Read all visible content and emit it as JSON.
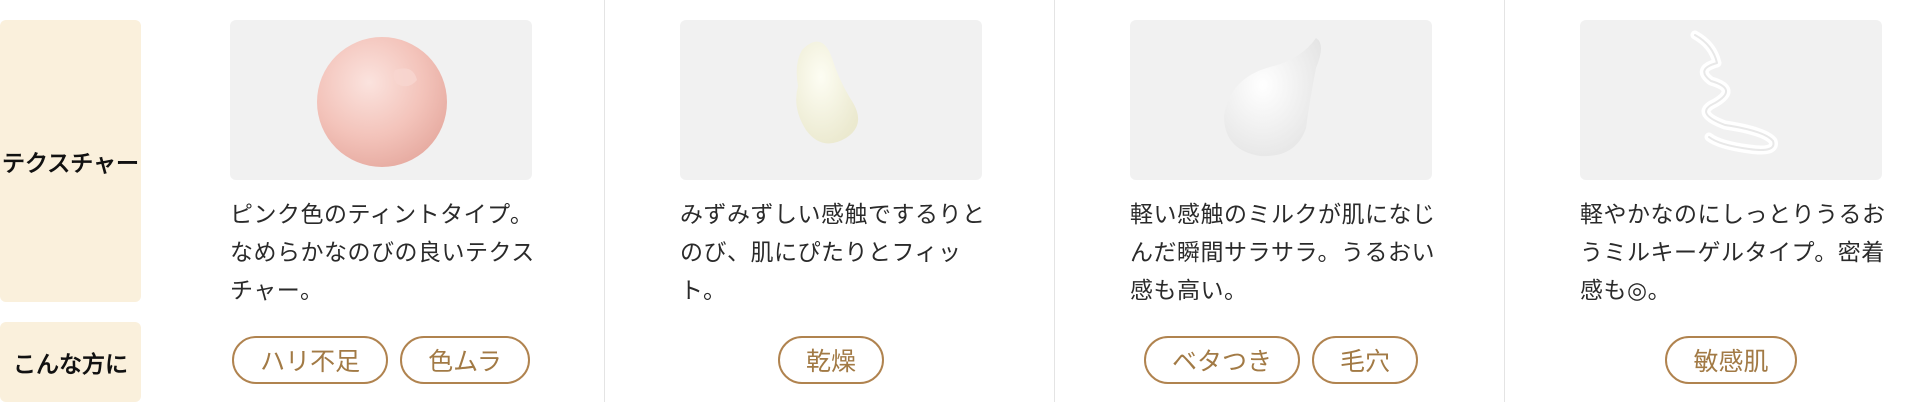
{
  "row_labels": {
    "texture": "テクスチャー",
    "recommended_for": "こんな方に"
  },
  "products": [
    {
      "texture_image": "pink-tint-swatch",
      "description": "ピンク色のティントタイプ。なめらかなのびの良いテクスチャー。",
      "tags": [
        "ハリ不足",
        "色ムラ"
      ]
    },
    {
      "texture_image": "cream-emulsion-swatch",
      "description": "みずみずしい感触でするりとのび、肌にぴたりとフィット。",
      "tags": [
        "乾燥"
      ]
    },
    {
      "texture_image": "white-milk-swatch",
      "description": "軽い感触のミルクが肌になじんだ瞬間サラサラ。うるおい感も高い。",
      "tags": [
        "ベタつき",
        "毛穴"
      ]
    },
    {
      "texture_image": "gel-swirl-swatch",
      "description": "軽やかなのにしっとりうるおうミルキーゲルタイプ。密着感も◎。",
      "tags": [
        "敏感肌"
      ]
    }
  ],
  "colors": {
    "label_bg": "#faf0dc",
    "tag_border": "#b0834f",
    "tag_text": "#a27a45",
    "image_bg": "#f1f1f1"
  }
}
